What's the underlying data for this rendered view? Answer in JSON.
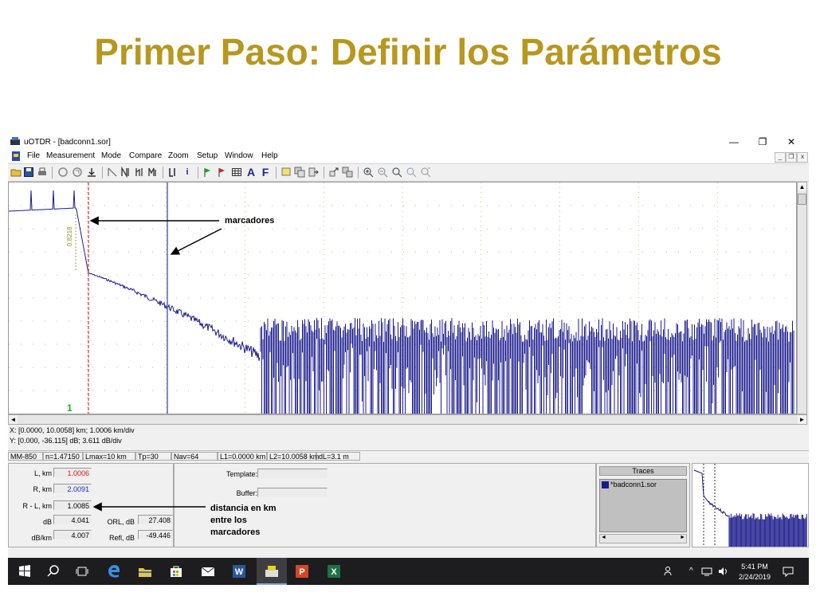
{
  "slide": {
    "title": "Primer Paso: Definir los Parámetros"
  },
  "window": {
    "title": "uOTDR - [badconn1.sor]",
    "controls": {
      "minimize": "—",
      "restore": "❐",
      "close": "✕"
    },
    "mdi_controls": {
      "minimize": "_",
      "restore": "❐",
      "close": "x"
    }
  },
  "menu": [
    "File",
    "Measurement",
    "Mode",
    "Compare",
    "Zoom",
    "Setup",
    "Window",
    "Help"
  ],
  "toolbar": {
    "group1": [
      "folder-open-icon",
      "save-icon",
      "print-icon"
    ],
    "group2": [
      "circle-icon",
      "refresh-icon",
      "arrow-down-icon"
    ],
    "group3": [
      "event-n-icon",
      "event-nr-icon",
      "event-tl-icon",
      "event-m-icon"
    ],
    "group4": [
      "marker-l-icon",
      "info-icon"
    ],
    "group5": [
      "flag-green-icon",
      "flag-red-icon",
      "table-icon",
      "font-a-icon",
      "font-f-icon"
    ],
    "group6": [
      "note-icon",
      "notes-icon",
      "export-icon"
    ],
    "group7": [
      "move-icon",
      "copy-icon"
    ],
    "group8": [
      "zoom-in-icon",
      "zoom-out-icon",
      "zoom-fit-icon",
      "zoom-reset-icon",
      "zoom-custom-icon"
    ],
    "text_glyphs": {
      "info": "i",
      "font_a": "A",
      "font_f": "F"
    }
  },
  "plot": {
    "marker_annotation": "0.8218",
    "trace_number": "1",
    "colors": {
      "trace": "#1a1a8c",
      "marker1": "#e03c3c",
      "marker2": "#3a4fb0",
      "number": "#22aa22"
    }
  },
  "scales": {
    "x": "X: [0.0000, 10.0058] km; 1.0006 km/div",
    "y": "Y: [0.000, -36.115] dB; 3.611 dB/div"
  },
  "status": {
    "mode": "MM-850",
    "n": "n=1.47150",
    "lmax": "Lmax=10 km",
    "tp": "Tp=30",
    "nav": "Nav=64",
    "l1": "L1=0.0000 km",
    "l2": "L2=10.0058 km",
    "dl": "dL=3.1 m"
  },
  "measurements": {
    "l_label": "L, km",
    "l_value": "1.0006",
    "r_label": "R, km",
    "r_value": "2.0091",
    "rl_label": "R - L, km",
    "rl_value": "1.0085",
    "db_label": "dB",
    "db_value": "4.041",
    "dbkm_label": "dB/km",
    "dbkm_value": "4.007",
    "orl_label": "ORL, dB",
    "orl_value": "27.408",
    "refl_label": "Refl, dB",
    "refl_value": "-49.446",
    "value_colors": {
      "l": "#d42020",
      "r": "#2030c0"
    }
  },
  "template": {
    "template_label": "Template:",
    "buffer_label": "Buffer:"
  },
  "traces": {
    "header": "Traces",
    "items": [
      "*badconn1.sor"
    ]
  },
  "annotations": {
    "marcadores": "marcadores",
    "distancia": [
      "distancia en km",
      "entre los",
      "marcadores"
    ]
  },
  "taskbar": {
    "apps": [
      "windows-start-icon",
      "search-icon",
      "task-view-icon",
      "edge-icon",
      "file-explorer-icon",
      "store-icon",
      "mail-icon",
      "word-icon",
      "otdr-app-icon",
      "powerpoint-icon",
      "excel-icon"
    ],
    "time": "5:41 PM",
    "date": "2/24/2019"
  }
}
